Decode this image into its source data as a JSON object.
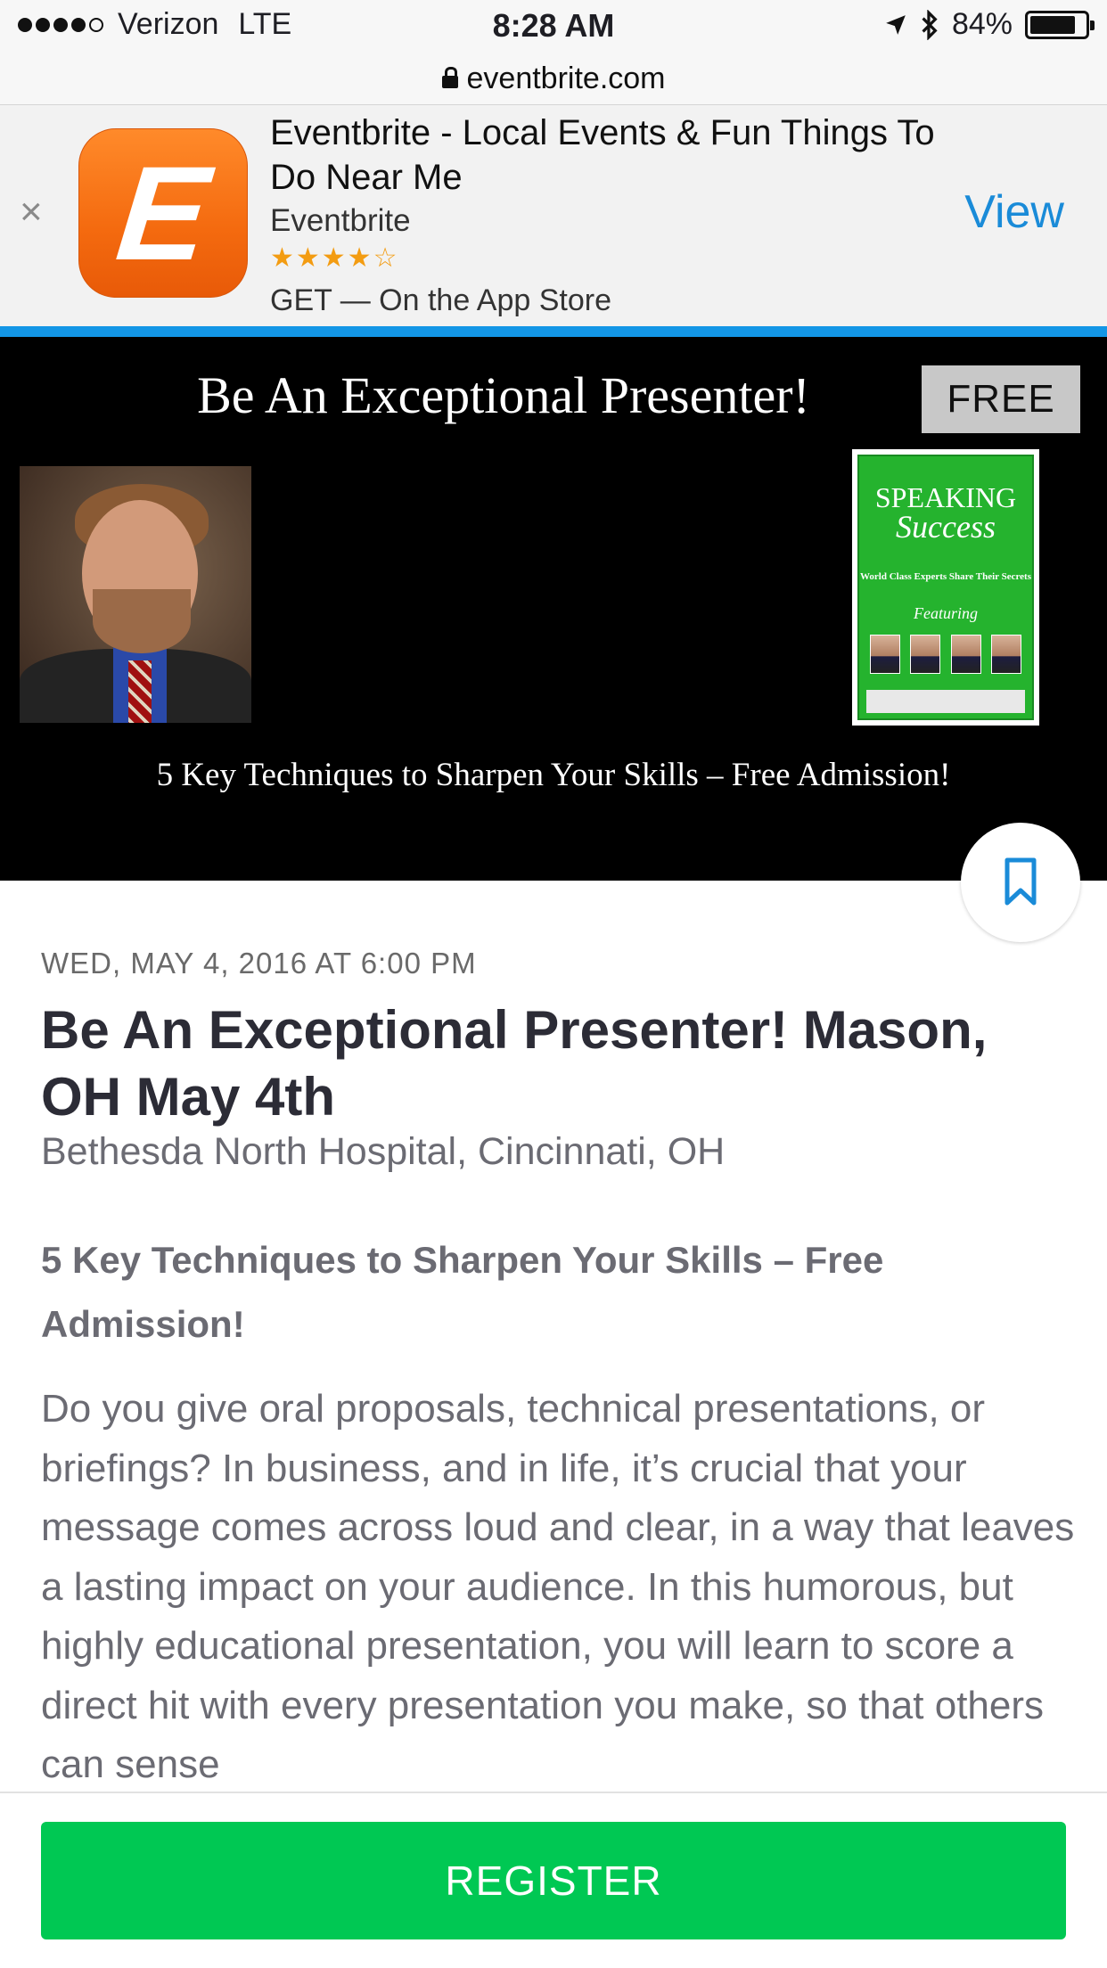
{
  "status_bar": {
    "carrier": "Verizon",
    "network": "LTE",
    "time": "8:28 AM",
    "battery": "84%",
    "signal_bars": 4,
    "signal_max": 5
  },
  "url_bar": {
    "domain": "eventbrite.com"
  },
  "app_banner": {
    "close_label": "×",
    "icon_letter": "E",
    "title": "Eventbrite - Local Events & Fun Things To Do Near Me",
    "developer": "Eventbrite",
    "stars": "★★★★☆",
    "rating": 4,
    "get_label": "GET — On the App Store",
    "view_label": "View",
    "accent_color": "#1a8bd8"
  },
  "hero": {
    "title": "Be An Exceptional Presenter!",
    "badge": "FREE",
    "subtitle": "5 Key Techniques to Sharpen Your Skills – Free Admission!",
    "book": {
      "line1": "SPEAKING",
      "line2": "Success",
      "tagline": "World Class Experts Share Their Secrets",
      "featuring": "Featuring"
    }
  },
  "event": {
    "date": "WED, MAY 4, 2016 AT 6:00 PM",
    "title": "Be An Exceptional Presenter! Mason, OH May 4th",
    "venue": "Bethesda North Hospital, Cincinnati, OH",
    "summary": "5 Key Techniques to Sharpen Your Skills – Free Admission!",
    "description": "Do you give oral proposals, technical presentations, or briefings? In business, and in life, it’s crucial that your message comes across loud and clear, in a way that leaves a lasting impact on your audience. In this humorous, but highly educational presentation, you will learn to score a direct hit with every presentation you make, so that others can sense"
  },
  "register": {
    "label": "REGISTER",
    "color": "#00c853"
  },
  "icons": [
    "lock-icon",
    "location-arrow-icon",
    "bluetooth-icon",
    "battery-icon",
    "close-icon",
    "bookmark-icon"
  ]
}
